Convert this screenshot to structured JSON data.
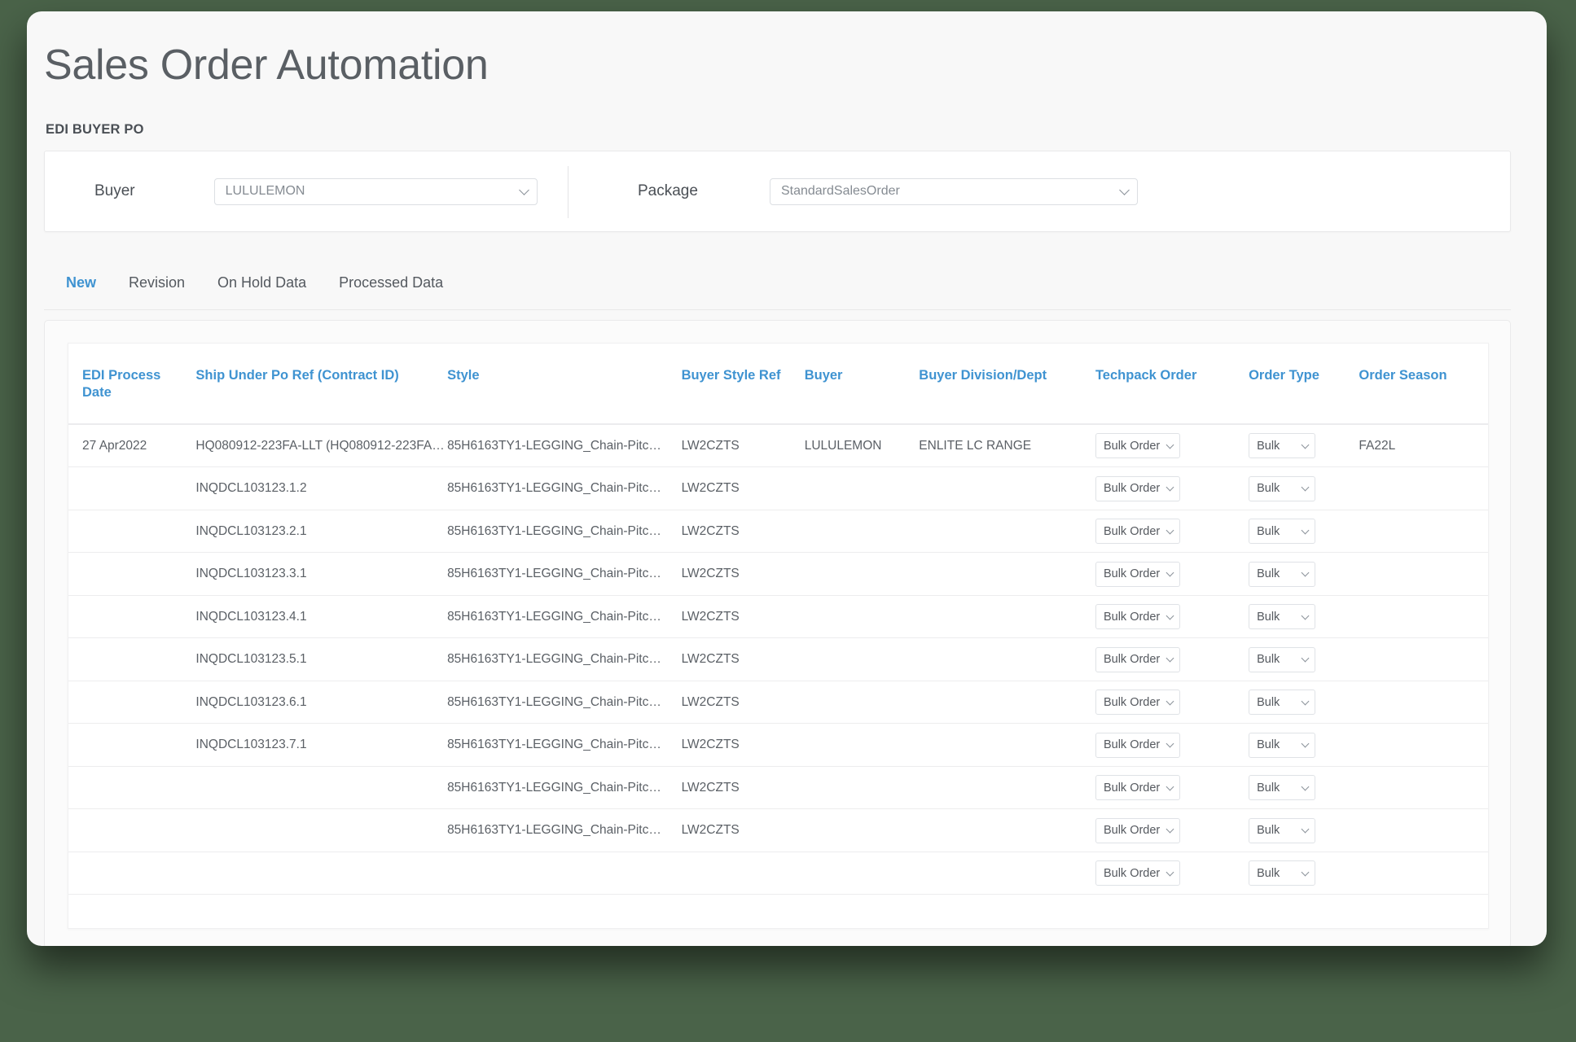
{
  "page": {
    "title": "Sales Order Automation",
    "section_label": "EDI  BUYER PO",
    "accent_color": "#3f93d1",
    "background_color": "#4a6349",
    "card_color": "#f8f8f8"
  },
  "filters": {
    "buyer": {
      "label": "Buyer",
      "value": "LULULEMON"
    },
    "package": {
      "label": "Package",
      "value": "StandardSalesOrder"
    }
  },
  "tabs": [
    {
      "label": "New",
      "active": true
    },
    {
      "label": "Revision",
      "active": false
    },
    {
      "label": "On Hold Data",
      "active": false
    },
    {
      "label": "Processed Data",
      "active": false
    }
  ],
  "table": {
    "columns": [
      "EDI Process Date",
      "Ship Under Po Ref (Contract ID)",
      "Style",
      "Buyer Style Ref",
      "Buyer",
      "Buyer Division/Dept",
      "Techpack Order",
      "Order Type",
      "Order Season"
    ],
    "rows": [
      {
        "edi_process_date": "27 Apr2022",
        "ship_under_po_ref": "HQ080912-223FA-LLT (HQ080912-223FA…",
        "style": "85H6163TY1-LEGGING_Chain-Pitc…",
        "buyer_style_ref": "LW2CZTS",
        "buyer": "LULULEMON",
        "buyer_division_dept": "ENLITE LC RANGE",
        "techpack_order": "Bulk Order",
        "order_type": "Bulk",
        "order_season": "FA22L"
      },
      {
        "edi_process_date": "",
        "ship_under_po_ref": "INQDCL103123.1.2",
        "style": "85H6163TY1-LEGGING_Chain-Pitc…",
        "buyer_style_ref": "LW2CZTS",
        "buyer": "",
        "buyer_division_dept": "",
        "techpack_order": "Bulk Order",
        "order_type": "Bulk",
        "order_season": ""
      },
      {
        "edi_process_date": "",
        "ship_under_po_ref": "INQDCL103123.2.1",
        "style": "85H6163TY1-LEGGING_Chain-Pitc…",
        "buyer_style_ref": "LW2CZTS",
        "buyer": "",
        "buyer_division_dept": "",
        "techpack_order": "Bulk Order",
        "order_type": "Bulk",
        "order_season": ""
      },
      {
        "edi_process_date": "",
        "ship_under_po_ref": "INQDCL103123.3.1",
        "style": "85H6163TY1-LEGGING_Chain-Pitc…",
        "buyer_style_ref": "LW2CZTS",
        "buyer": "",
        "buyer_division_dept": "",
        "techpack_order": "Bulk Order",
        "order_type": "Bulk",
        "order_season": ""
      },
      {
        "edi_process_date": "",
        "ship_under_po_ref": "INQDCL103123.4.1",
        "style": "85H6163TY1-LEGGING_Chain-Pitc…",
        "buyer_style_ref": "LW2CZTS",
        "buyer": "",
        "buyer_division_dept": "",
        "techpack_order": "Bulk Order",
        "order_type": "Bulk",
        "order_season": ""
      },
      {
        "edi_process_date": "",
        "ship_under_po_ref": "INQDCL103123.5.1",
        "style": "85H6163TY1-LEGGING_Chain-Pitc…",
        "buyer_style_ref": "LW2CZTS",
        "buyer": "",
        "buyer_division_dept": "",
        "techpack_order": "Bulk Order",
        "order_type": "Bulk",
        "order_season": ""
      },
      {
        "edi_process_date": "",
        "ship_under_po_ref": "INQDCL103123.6.1",
        "style": "85H6163TY1-LEGGING_Chain-Pitc…",
        "buyer_style_ref": "LW2CZTS",
        "buyer": "",
        "buyer_division_dept": "",
        "techpack_order": "Bulk Order",
        "order_type": "Bulk",
        "order_season": ""
      },
      {
        "edi_process_date": "",
        "ship_under_po_ref": "INQDCL103123.7.1",
        "style": "85H6163TY1-LEGGING_Chain-Pitc…",
        "buyer_style_ref": "LW2CZTS",
        "buyer": "",
        "buyer_division_dept": "",
        "techpack_order": "Bulk Order",
        "order_type": "Bulk",
        "order_season": ""
      },
      {
        "edi_process_date": "",
        "ship_under_po_ref": "",
        "style": "85H6163TY1-LEGGING_Chain-Pitc…",
        "buyer_style_ref": "LW2CZTS",
        "buyer": "",
        "buyer_division_dept": "",
        "techpack_order": "Bulk Order",
        "order_type": "Bulk",
        "order_season": ""
      },
      {
        "edi_process_date": "",
        "ship_under_po_ref": "",
        "style": "85H6163TY1-LEGGING_Chain-Pitc…",
        "buyer_style_ref": "LW2CZTS",
        "buyer": "",
        "buyer_division_dept": "",
        "techpack_order": "Bulk Order",
        "order_type": "Bulk",
        "order_season": ""
      },
      {
        "edi_process_date": "",
        "ship_under_po_ref": "",
        "style": "",
        "buyer_style_ref": "",
        "buyer": "",
        "buyer_division_dept": "",
        "techpack_order": "Bulk Order",
        "order_type": "Bulk",
        "order_season": ""
      }
    ]
  },
  "icons": {
    "chevron_down": "chevron-down-icon"
  }
}
